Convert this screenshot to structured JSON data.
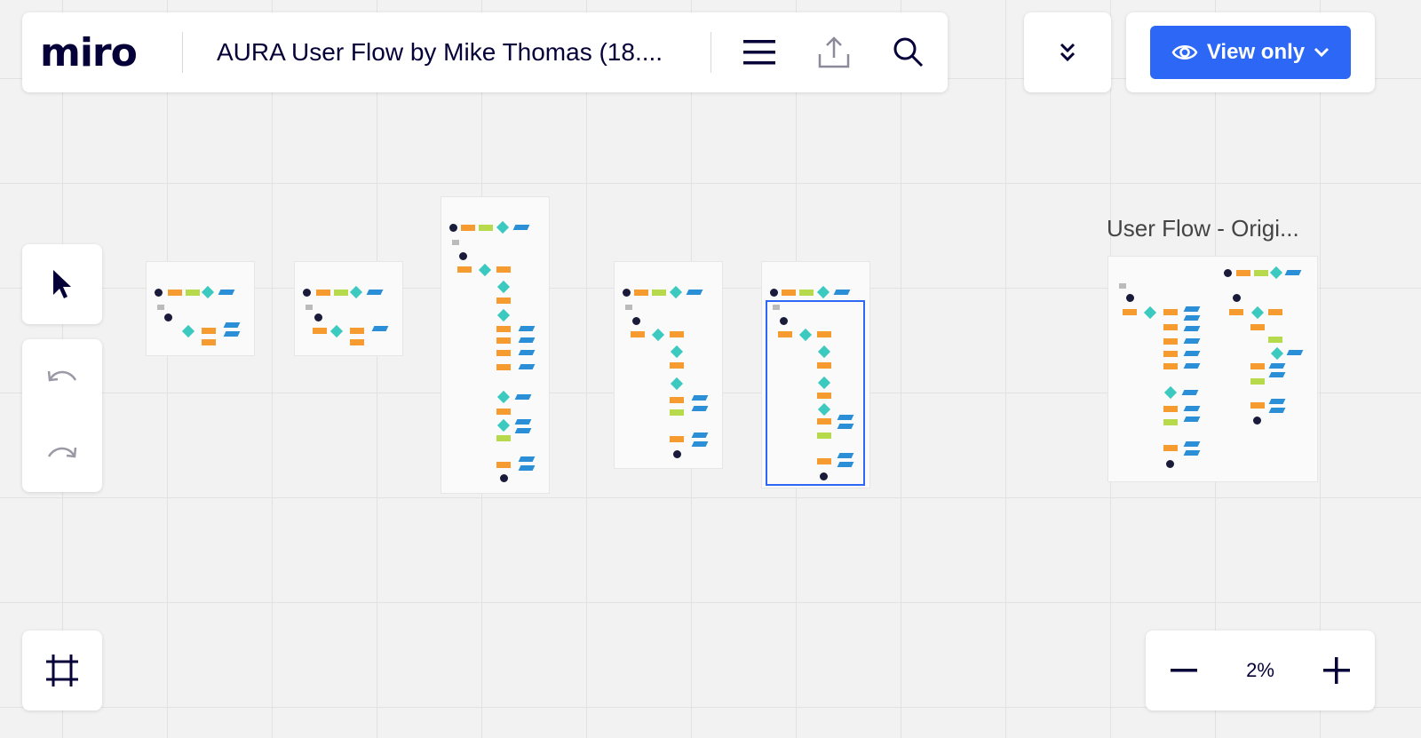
{
  "header": {
    "logo": "miro",
    "board_title": "AURA User Flow by Mike Thomas (18...."
  },
  "toolbar": {
    "icons": [
      "menu-icon",
      "upload-icon",
      "search-icon"
    ]
  },
  "view_mode": {
    "label": "View only",
    "icon": "eye-icon",
    "dropdown_icon": "chevron-down-icon"
  },
  "expand_icon": "double-chevron-down-icon",
  "left_tools": {
    "select_icon": "cursor-icon",
    "undo_icon": "undo-icon",
    "redo_icon": "redo-icon",
    "frames_icon": "frame-icon"
  },
  "zoom": {
    "minus_icon": "minus-icon",
    "level": "2%",
    "plus_icon": "plus-icon"
  },
  "canvas": {
    "section_label": "User Flow - Origi..."
  },
  "colors": {
    "brand_blue": "#2d67f5",
    "text_dark": "#050038",
    "flow_orange": "#f59b30",
    "flow_teal": "#3cc9c0",
    "flow_blue": "#2a8fd6",
    "flow_green": "#b7d94c"
  }
}
